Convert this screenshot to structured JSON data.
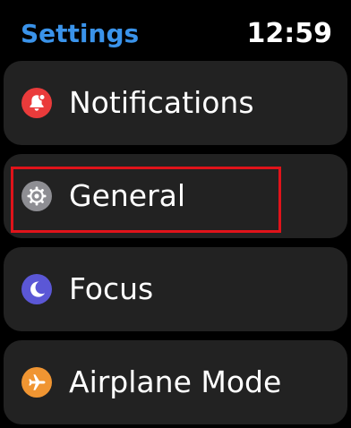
{
  "header": {
    "title": "Settings",
    "time": "12:59"
  },
  "colors": {
    "accent": "#3a93ea",
    "highlight": "#e0131a",
    "notifications_icon": "#ea3b3b",
    "general_icon": "#8e8e93",
    "focus_icon": "#5b57d6",
    "airplane_icon": "#f09532"
  },
  "items": [
    {
      "label": "Notifications",
      "icon": "bell-icon"
    },
    {
      "label": "General",
      "icon": "gear-icon"
    },
    {
      "label": "Focus",
      "icon": "moon-icon"
    },
    {
      "label": "Airplane Mode",
      "icon": "airplane-icon"
    }
  ]
}
